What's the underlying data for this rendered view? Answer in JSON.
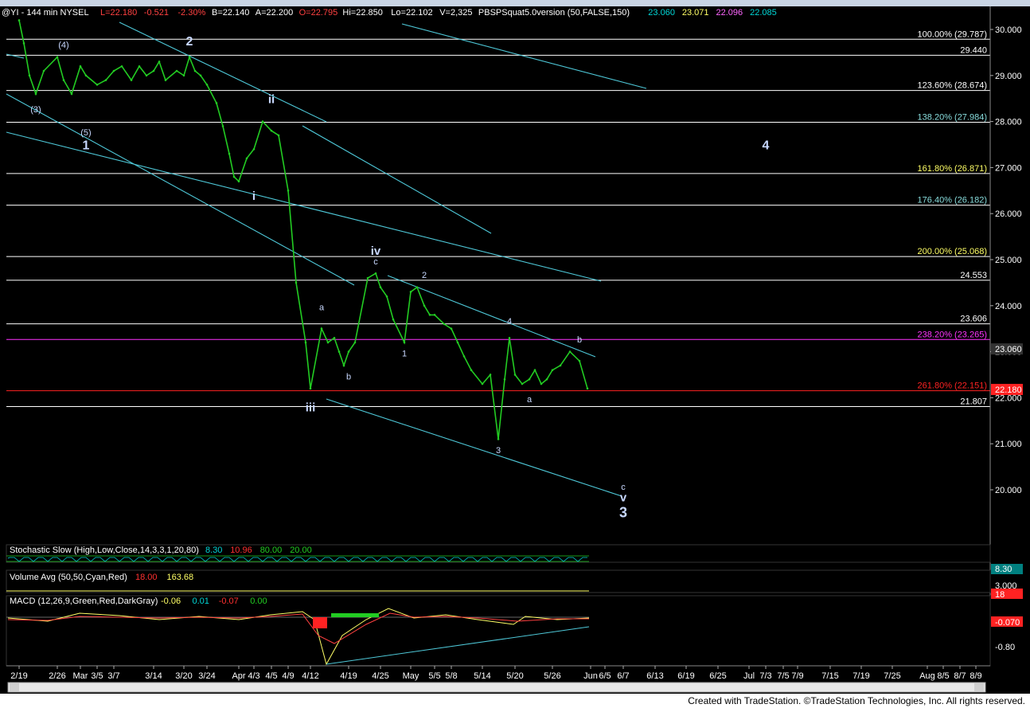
{
  "window": {
    "footer": "Created with TradeStation. ©TradeStation Technologies, Inc. All rights reserved."
  },
  "colors": {
    "price_line": "#22cc22",
    "trendline": "#4ec8d8",
    "fib_line": "#ffffff",
    "highlight_magenta": "#ff33ff",
    "highlight_red": "#ff2222",
    "last_price_bg": "#ff2222",
    "stoch_k": "#00d6d6",
    "stoch_d": "#ff3030"
  },
  "header": {
    "symbol": "@YI - 144 min  NYSEL",
    "fields": [
      {
        "text": "L=22.180",
        "color": "#ff4040"
      },
      {
        "text": "-0.521",
        "color": "#ff4040"
      },
      {
        "text": "-2.30%",
        "color": "#ff4040"
      },
      {
        "text": "B=22.140",
        "color": "#ffffff"
      },
      {
        "text": "A=22.200",
        "color": "#ffffff"
      },
      {
        "text": "O=22.795",
        "color": "#ff4040"
      },
      {
        "text": "Hi=22.850",
        "color": "#ffffff"
      },
      {
        "text": "Lo=22.102",
        "color": "#ffffff"
      },
      {
        "text": "V=2,325",
        "color": "#ffffff"
      },
      {
        "text": "PBSPSquat5.0version (50,FALSE,150)",
        "color": "#ffffff"
      },
      {
        "text": "23.060",
        "color": "#00d6d6"
      },
      {
        "text": "23.071",
        "color": "#ffff66"
      },
      {
        "text": "22.096",
        "color": "#ff66ff"
      },
      {
        "text": "22.085",
        "color": "#00d6d6"
      }
    ]
  },
  "chart_data": {
    "type": "line",
    "title": "",
    "ylim": [
      19.0,
      30.2
    ],
    "y_ticks": [
      30.0,
      29.0,
      28.0,
      27.0,
      26.0,
      25.0,
      24.0,
      23.0,
      22.0,
      21.0,
      20.0
    ],
    "y_tick_labels": [
      "30.000",
      "29.000",
      "28.000",
      "27.000",
      "26.000",
      "25.000",
      "24.000",
      "23.000",
      "22.000",
      "21.000",
      "20.000"
    ],
    "x_ticks": [
      "2/19",
      "2/26",
      "Mar",
      "3/5",
      "3/7",
      "3/14",
      "3/20",
      "3/24",
      "Apr",
      "4/3",
      "4/5",
      "4/9",
      "4/12",
      "4/19",
      "4/25",
      "May",
      "5/5",
      "5/8",
      "5/14",
      "5/20",
      "5/26",
      "Jun",
      "6/5",
      "6/7",
      "6/13",
      "6/19",
      "6/25",
      "Jul",
      "7/3",
      "7/5",
      "7/9",
      "7/15",
      "7/19",
      "7/25",
      "Aug",
      "8/5",
      "8/7",
      "8/9"
    ],
    "series": [
      {
        "x": [
          "2/19",
          "2/20",
          "2/21",
          "2/22",
          "2/23",
          "2/26",
          "2/27",
          "2/28",
          "Mar",
          "3/2",
          "3/5",
          "3/6",
          "3/7",
          "3/8",
          "3/9",
          "3/12",
          "3/13",
          "3/14",
          "3/15",
          "3/16",
          "3/19",
          "3/20",
          "3/21",
          "3/22",
          "3/23",
          "3/24",
          "3/26",
          "3/27",
          "3/28",
          "3/29",
          "Apr",
          "4/2",
          "4/3",
          "4/4",
          "4/5",
          "4/6",
          "4/9",
          "4/10",
          "4/11",
          "4/12",
          "4/13",
          "4/14",
          "4/16",
          "4/17",
          "4/18",
          "4/19",
          "4/20",
          "4/23",
          "4/24",
          "4/25",
          "4/26",
          "4/27",
          "4/30",
          "May",
          "5/2",
          "5/3",
          "5/4",
          "5/5",
          "5/7",
          "5/8",
          "5/9",
          "5/10",
          "5/11",
          "5/14",
          "5/15",
          "5/16",
          "5/17",
          "5/18",
          "5/20",
          "5/21",
          "5/22",
          "5/23",
          "5/24",
          "5/25",
          "5/26",
          "5/28",
          "5/29",
          "5/30",
          "5/31"
        ],
        "values": [
          30.2,
          29.7,
          29.0,
          28.6,
          29.1,
          29.4,
          28.9,
          28.6,
          29.2,
          29.0,
          28.8,
          28.9,
          29.1,
          29.2,
          28.9,
          29.2,
          29.0,
          29.1,
          29.3,
          28.9,
          29.1,
          29.0,
          29.4,
          29.1,
          29.0,
          28.8,
          28.4,
          27.9,
          27.3,
          26.8,
          26.7,
          27.2,
          27.4,
          28.0,
          27.8,
          27.7,
          26.5,
          24.5,
          23.2,
          22.2,
          23.5,
          23.2,
          23.3,
          23.0,
          22.7,
          23.0,
          23.2,
          24.6,
          24.7,
          24.4,
          24.2,
          23.7,
          23.2,
          24.3,
          24.4,
          24.0,
          23.8,
          23.8,
          23.6,
          23.5,
          23.2,
          22.9,
          22.6,
          22.3,
          22.5,
          21.1,
          22.4,
          23.3,
          22.5,
          22.3,
          22.4,
          22.6,
          22.3,
          22.4,
          22.6,
          22.7,
          23.0,
          22.8,
          22.2
        ]
      }
    ],
    "fib_levels": [
      {
        "label": "100.00% (29.787)",
        "value": 29.787
      },
      {
        "label": "29.440",
        "value": 29.44
      },
      {
        "label": "123.60% (28.674)",
        "value": 28.674
      },
      {
        "label": "138.20% (27.984)",
        "value": 27.984
      },
      {
        "label": "161.80% (26.871)",
        "value": 26.871
      },
      {
        "label": "176.40% (26.182)",
        "value": 26.182
      },
      {
        "label": "200.00% (25.068)",
        "value": 25.068
      },
      {
        "label": "24.553",
        "value": 24.553
      },
      {
        "label": "23.606",
        "value": 23.606
      },
      {
        "label": "238.20% (23.265)",
        "value": 23.265
      },
      {
        "label": "261.80% (22.151)",
        "value": 22.151
      },
      {
        "label": "21.807",
        "value": 21.807
      }
    ],
    "price_flags": [
      {
        "label": "23.060",
        "value": 23.06
      },
      {
        "label": "22.180",
        "value": 22.18
      }
    ],
    "wave_labels": [
      {
        "text": "(4)",
        "x": "2/27",
        "y": 29.6
      },
      {
        "text": "(3)",
        "x": "2/22",
        "y": 28.2
      },
      {
        "text": "(5)",
        "x": "3/2",
        "y": 27.7
      },
      {
        "text": "1",
        "x": "3/2",
        "y": 27.4
      },
      {
        "text": "2",
        "x": "3/21",
        "y": 29.65
      },
      {
        "text": "ii",
        "x": "4/5",
        "y": 28.4
      },
      {
        "text": "i",
        "x": "4/3",
        "y": 26.3
      },
      {
        "text": "iii",
        "x": "4/12",
        "y": 21.7
      },
      {
        "text": "iv",
        "x": "4/24",
        "y": 25.1
      },
      {
        "text": "a",
        "x": "4/13",
        "y": 23.9
      },
      {
        "text": "b",
        "x": "4/19",
        "y": 22.4
      },
      {
        "text": "c",
        "x": "4/24",
        "y": 24.9
      },
      {
        "text": "1",
        "x": "4/30",
        "y": 22.9
      },
      {
        "text": "2",
        "x": "5/3",
        "y": 24.6
      },
      {
        "text": "3",
        "x": "5/16",
        "y": 20.8
      },
      {
        "text": "4",
        "x": "5/18",
        "y": 23.6
      },
      {
        "text": "a",
        "x": "5/22",
        "y": 21.9
      },
      {
        "text": "b",
        "x": "5/30",
        "y": 23.2
      },
      {
        "text": "c",
        "x": "6/7",
        "y": 20.0
      },
      {
        "text": "v",
        "x": "6/7",
        "y": 19.75
      },
      {
        "text": "3",
        "x": "6/7",
        "y": 19.4
      },
      {
        "text": "4",
        "x": "7/3",
        "y": 27.4
      }
    ]
  },
  "indicators": {
    "stochastic": {
      "label": "Stochastic Slow (High,Low,Close,14,3,3,1,20,80)",
      "values": [
        {
          "text": "8.30",
          "color": "#00d6d6"
        },
        {
          "text": "10.96",
          "color": "#ff3030"
        },
        {
          "text": "80.00",
          "color": "#22cc22"
        },
        {
          "text": "20.00",
          "color": "#22cc22"
        }
      ],
      "flag": "8.30"
    },
    "volume": {
      "label": "Volume Avg (50,50,Cyan,Red)",
      "values": [
        {
          "text": "18.00",
          "color": "#ff3030"
        },
        {
          "text": "163.68",
          "color": "#ffff66"
        }
      ],
      "tick": "3,000",
      "flag": "18"
    },
    "macd": {
      "label": "MACD (12,26,9,Green,Red,DarkGray)",
      "values": [
        {
          "text": "-0.06",
          "color": "#ffff66"
        },
        {
          "text": "0.01",
          "color": "#00d6d6"
        },
        {
          "text": "-0.07",
          "color": "#ff3030"
        },
        {
          "text": "0.00",
          "color": "#22cc22"
        }
      ],
      "tick": "-0.80",
      "flag": "-0.070"
    }
  }
}
